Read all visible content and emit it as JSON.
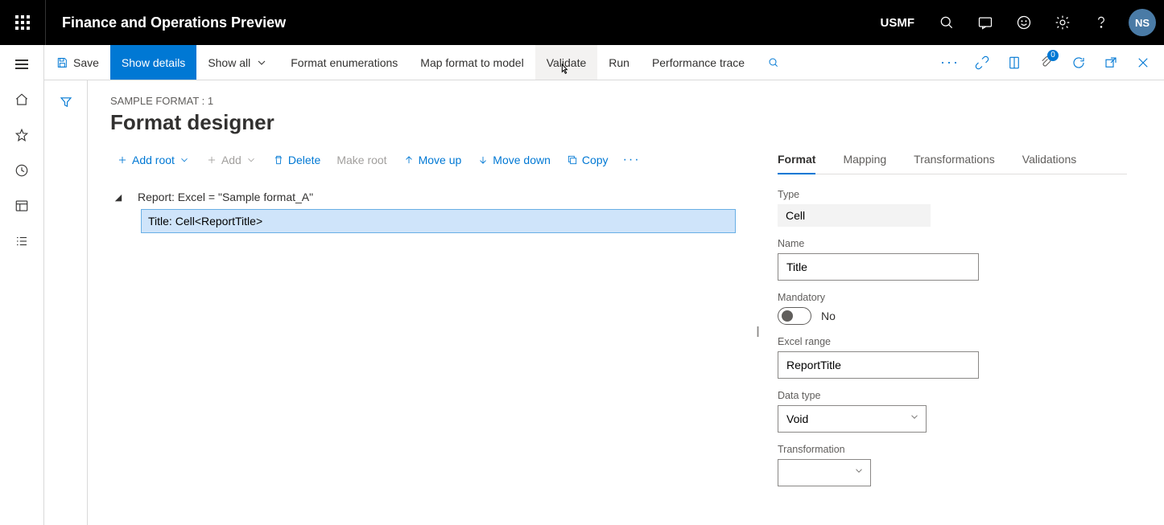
{
  "header": {
    "app_title": "Finance and Operations Preview",
    "legal_entity": "USMF",
    "avatar_initials": "NS"
  },
  "action_bar": {
    "save": "Save",
    "show_details": "Show details",
    "show_all": "Show all",
    "format_enumerations": "Format enumerations",
    "map_format_to_model": "Map format to model",
    "validate": "Validate",
    "run": "Run",
    "performance_trace": "Performance trace",
    "attachment_badge": "0"
  },
  "page": {
    "breadcrumb": "SAMPLE FORMAT : 1",
    "title": "Format designer"
  },
  "tree_toolbar": {
    "add_root": "Add root",
    "add": "Add",
    "delete": "Delete",
    "make_root": "Make root",
    "move_up": "Move up",
    "move_down": "Move down",
    "copy": "Copy"
  },
  "tree": {
    "root": "Report: Excel = \"Sample format_A\"",
    "child": "Title: Cell<ReportTitle>"
  },
  "tabs": {
    "format": "Format",
    "mapping": "Mapping",
    "transformations": "Transformations",
    "validations": "Validations"
  },
  "format_pane": {
    "type_label": "Type",
    "type_value": "Cell",
    "name_label": "Name",
    "name_value": "Title",
    "mandatory_label": "Mandatory",
    "mandatory_value": "No",
    "excel_range_label": "Excel range",
    "excel_range_value": "ReportTitle",
    "data_type_label": "Data type",
    "data_type_value": "Void",
    "transformation_label": "Transformation",
    "transformation_value": ""
  }
}
